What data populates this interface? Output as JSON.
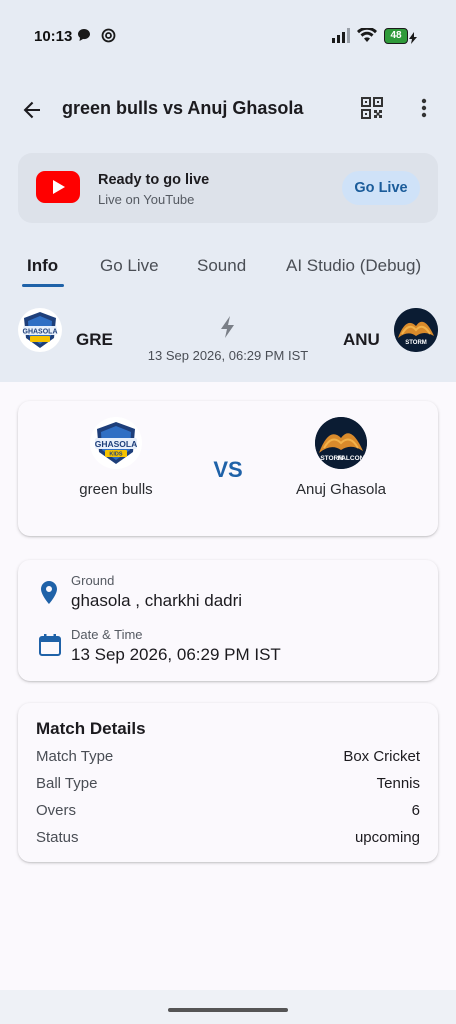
{
  "status_bar": {
    "time": "10:13",
    "battery": "48"
  },
  "app_bar": {
    "title": "green bulls vs Anuj Ghasola"
  },
  "live_card": {
    "title": "Ready to go live",
    "subtitle": "Live on YouTube",
    "button": "Go Live"
  },
  "tabs": [
    {
      "label": "Info",
      "active": true
    },
    {
      "label": "Go Live",
      "active": false
    },
    {
      "label": "Sound",
      "active": false
    },
    {
      "label": "AI Studio (Debug)",
      "active": false
    }
  ],
  "score_strip": {
    "team_a_abbr": "GRE",
    "team_b_abbr": "ANU",
    "datetime": "13 Sep 2026, 06:29 PM IST"
  },
  "match_card": {
    "team_a": "green bulls",
    "vs": "VS",
    "team_b": "Anuj Ghasola"
  },
  "team_logos": {
    "team_a": {
      "line1": "GHASOLA",
      "line2": "KIDS"
    },
    "team_b": {
      "line1": "STORM",
      "line2": "FALCON"
    }
  },
  "info_card": {
    "ground_label": "Ground",
    "ground_value": "ghasola , charkhi dadri",
    "datetime_label": "Date & Time",
    "datetime_value": "13 Sep 2026, 06:29 PM IST"
  },
  "match_details": {
    "title": "Match Details",
    "rows": [
      {
        "key": "Match Type",
        "value": "Box Cricket"
      },
      {
        "key": "Ball Type",
        "value": "Tennis"
      },
      {
        "key": "Overs",
        "value": "6"
      },
      {
        "key": "Status",
        "value": "upcoming"
      }
    ]
  },
  "colors": {
    "accent": "#1f62a8",
    "youtube": "#ff0000",
    "top_bg": "#e6ebf3"
  }
}
